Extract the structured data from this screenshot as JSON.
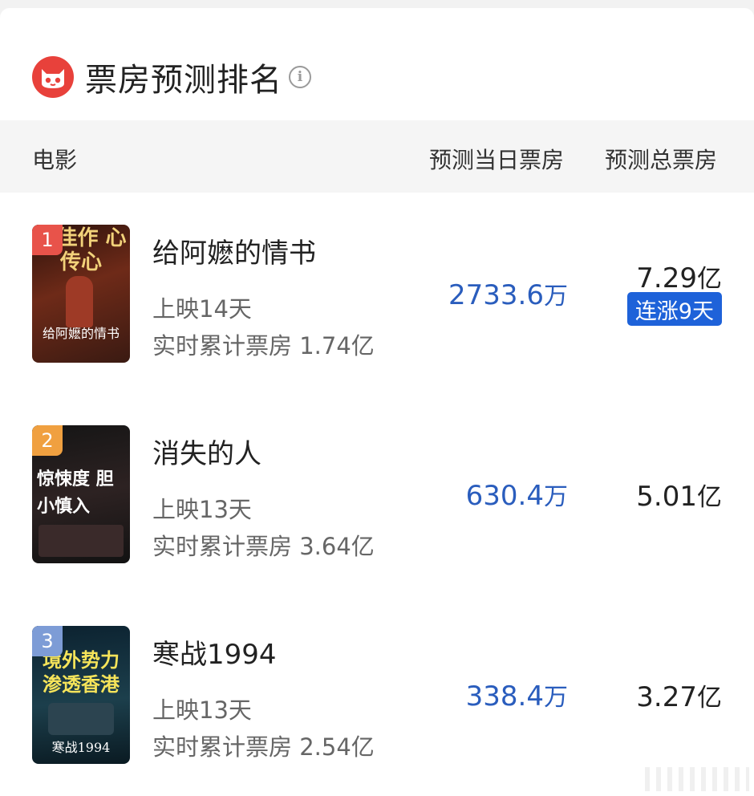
{
  "header": {
    "title": "票房预测排名",
    "info_icon": "i",
    "logo_icon": "cat-logo-icon",
    "accent_color": "#e8413b"
  },
  "columns": {
    "movie": "电影",
    "daily": "预测当日票房",
    "total": "预测总票房"
  },
  "movies": [
    {
      "rank": "1",
      "rank_color": "#e8534a",
      "name": "给阿嬷的情书",
      "days": "上映14天",
      "cumulative": "实时累计票房 1.74亿",
      "daily_value": "2733.6",
      "daily_unit": "万",
      "total_value": "7.29",
      "total_unit": "亿",
      "badge": "连涨9天",
      "poster_text": "碑佳作 心传心",
      "poster_bottom": "给阿嬷的情书",
      "poster_colors": [
        "#3a1a12",
        "#8a3a22"
      ]
    },
    {
      "rank": "2",
      "rank_color": "#f0a040",
      "name": "消失的人",
      "days": "上映13天",
      "cumulative": "实时累计票房 3.64亿",
      "daily_value": "630.4",
      "daily_unit": "万",
      "total_value": "5.01",
      "total_unit": "亿",
      "badge": "",
      "poster_text": "惊悚度 胆小慎入",
      "poster_bottom": "",
      "poster_colors": [
        "#1c1c1c",
        "#4a2420"
      ]
    },
    {
      "rank": "3",
      "rank_color": "#7d9cd6",
      "name": "寒战1994",
      "days": "上映13天",
      "cumulative": "实时累计票房 2.54亿",
      "daily_value": "338.4",
      "daily_unit": "万",
      "total_value": "3.27",
      "total_unit": "亿",
      "badge": "",
      "poster_text": "境外势力 渗透香港",
      "poster_bottom": "寒战1994",
      "poster_colors": [
        "#0e2a3a",
        "#1f4a5a"
      ]
    }
  ]
}
